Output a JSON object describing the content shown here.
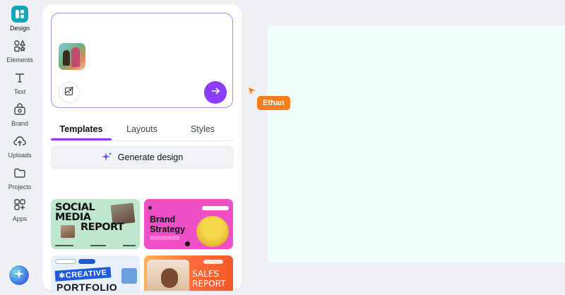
{
  "rail": {
    "items": [
      {
        "label": "Design",
        "icon": "design-icon",
        "active": true
      },
      {
        "label": "Elements",
        "icon": "elements-icon"
      },
      {
        "label": "Text",
        "icon": "text-icon"
      },
      {
        "label": "Brand",
        "icon": "brand-icon"
      },
      {
        "label": "Uploads",
        "icon": "uploads-icon"
      },
      {
        "label": "Projects",
        "icon": "projects-icon"
      },
      {
        "label": "Apps",
        "icon": "apps-icon"
      }
    ],
    "magic_button_icon": "sparkle-icon"
  },
  "prompt": {
    "add_image_icon": "add-image-icon",
    "send_icon": "arrow-right-icon"
  },
  "tabs": [
    {
      "label": "Templates",
      "active": true
    },
    {
      "label": "Layouts"
    },
    {
      "label": "Styles"
    }
  ],
  "generate": {
    "label": "Generate design",
    "icon": "sparkle-icon"
  },
  "templates": [
    {
      "lines": [
        "SOCIAL",
        "MEDIA",
        "REPORT"
      ],
      "color": "#bfe6cf"
    },
    {
      "lines": [
        "Brand",
        "Strategy"
      ],
      "color": "#ee4fc7"
    },
    {
      "lines": [
        "✱CREATIVE",
        "PORTFOLIO"
      ],
      "color": "#e8f1fb"
    },
    {
      "lines": [
        "SALES",
        "REPORT"
      ],
      "color": "#ff7a3c"
    }
  ],
  "collaborator": {
    "name": "Ethan",
    "color": "#f57f20"
  },
  "colors": {
    "accent": "#8b3dff",
    "brand_teal": "#12a8b8",
    "canvas": "#effdfb"
  }
}
